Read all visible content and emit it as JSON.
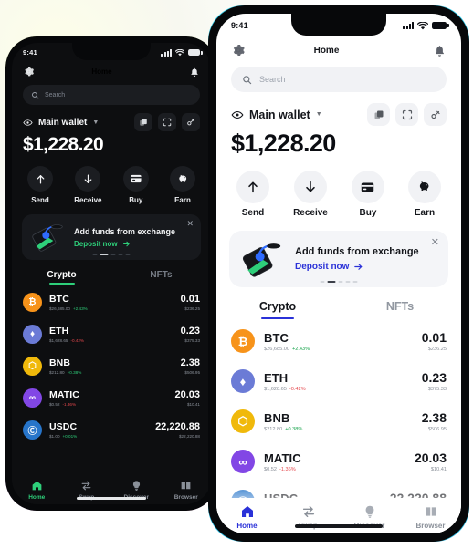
{
  "theme_colors": {
    "light_accent": "#2a31d8",
    "dark_accent": "#2ecf7a",
    "light_bg": "#ffffff",
    "dark_bg": "#0d0e10",
    "light_rim": "#2bc9ec",
    "positive": "#2ecf7a",
    "negative": "#e5484d"
  },
  "status_bar": {
    "time": "9:41",
    "signal_icon": "cellular-bars-icon",
    "wifi_icon": "wifi-icon",
    "battery_icon": "battery-icon"
  },
  "header": {
    "title": "Home",
    "settings_icon": "gear-icon",
    "notifications_icon": "bell-icon"
  },
  "search": {
    "placeholder": "Search",
    "icon": "search-icon"
  },
  "wallet": {
    "eye_icon": "eye-icon",
    "name": "Main wallet",
    "caret_icon": "chevron-down-icon",
    "balance": "$1,228.20",
    "icons": [
      {
        "name": "copy-icon"
      },
      {
        "name": "scan-qr-icon"
      },
      {
        "name": "connect-link-icon"
      }
    ]
  },
  "actions": [
    {
      "label": "Send",
      "icon": "arrow-up-icon"
    },
    {
      "label": "Receive",
      "icon": "arrow-down-icon"
    },
    {
      "label": "Buy",
      "icon": "credit-card-icon"
    },
    {
      "label": "Earn",
      "icon": "piggy-bank-icon"
    }
  ],
  "banner": {
    "title": "Add funds from exchange",
    "link": "Deposit now",
    "link_arrow": "arrow-right-icon",
    "close_icon": "close-icon",
    "art_icon": "phone-deposit-illustration",
    "dots": 5,
    "active_dot": 2
  },
  "tabs": [
    {
      "label": "Crypto",
      "active": true
    },
    {
      "label": "NFTs",
      "active": false
    }
  ],
  "assets": [
    {
      "symbol": "BTC",
      "glyph": "₿",
      "color": "#f7931a",
      "price": "$26,685.00",
      "change": "+2.43%",
      "dir": "up",
      "amount": "0.01",
      "fiat": "$236.25"
    },
    {
      "symbol": "ETH",
      "glyph": "♦",
      "color": "#6b7bd6",
      "price": "$1,628.65",
      "change": "-0.42%",
      "dir": "down",
      "amount": "0.23",
      "fiat": "$375.33"
    },
    {
      "symbol": "BNB",
      "glyph": "⬡",
      "color": "#f0b90b",
      "price": "$212.80",
      "change": "+0.38%",
      "dir": "up",
      "amount": "2.38",
      "fiat": "$506.95"
    },
    {
      "symbol": "MATIC",
      "glyph": "∞",
      "color": "#8247e5",
      "price": "$0.52",
      "change": "-1.36%",
      "dir": "down",
      "amount": "20.03",
      "fiat": "$10.41"
    },
    {
      "symbol": "USDC",
      "glyph": "Ⓒ",
      "color": "#2775ca",
      "price": "$1.00",
      "change": "+0.01%",
      "dir": "up",
      "amount": "22,220.88",
      "fiat": "$22,220.88"
    }
  ],
  "bottom_nav": [
    {
      "label": "Home",
      "icon": "home-icon",
      "active": true
    },
    {
      "label": "Swap",
      "icon": "swap-icon",
      "active": false
    },
    {
      "label": "Discover",
      "icon": "bulb-icon",
      "active": false
    },
    {
      "label": "Browser",
      "icon": "browser-icon",
      "active": false
    }
  ]
}
